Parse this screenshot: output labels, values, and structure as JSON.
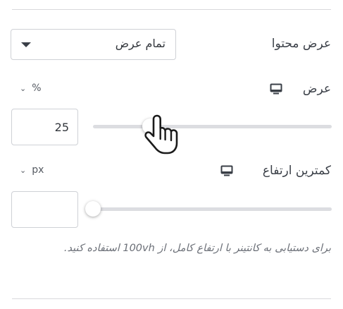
{
  "content_width": {
    "label": "عرض محتوا",
    "selected": "تمام عرض"
  },
  "width": {
    "label": "عرض",
    "unit": "%",
    "value": "25",
    "slider_fraction": 0.24,
    "device_icon": "monitor-icon"
  },
  "min_height": {
    "label": "کمترین ارتفاع",
    "unit": "px",
    "value": "",
    "slider_fraction": 0,
    "device_icon": "monitor-icon"
  },
  "help_text": "برای دستیابی به کانتینر با ارتفاع کامل، از 100vh استفاده کنید.",
  "cursor_icon": "hand-pointer-icon"
}
